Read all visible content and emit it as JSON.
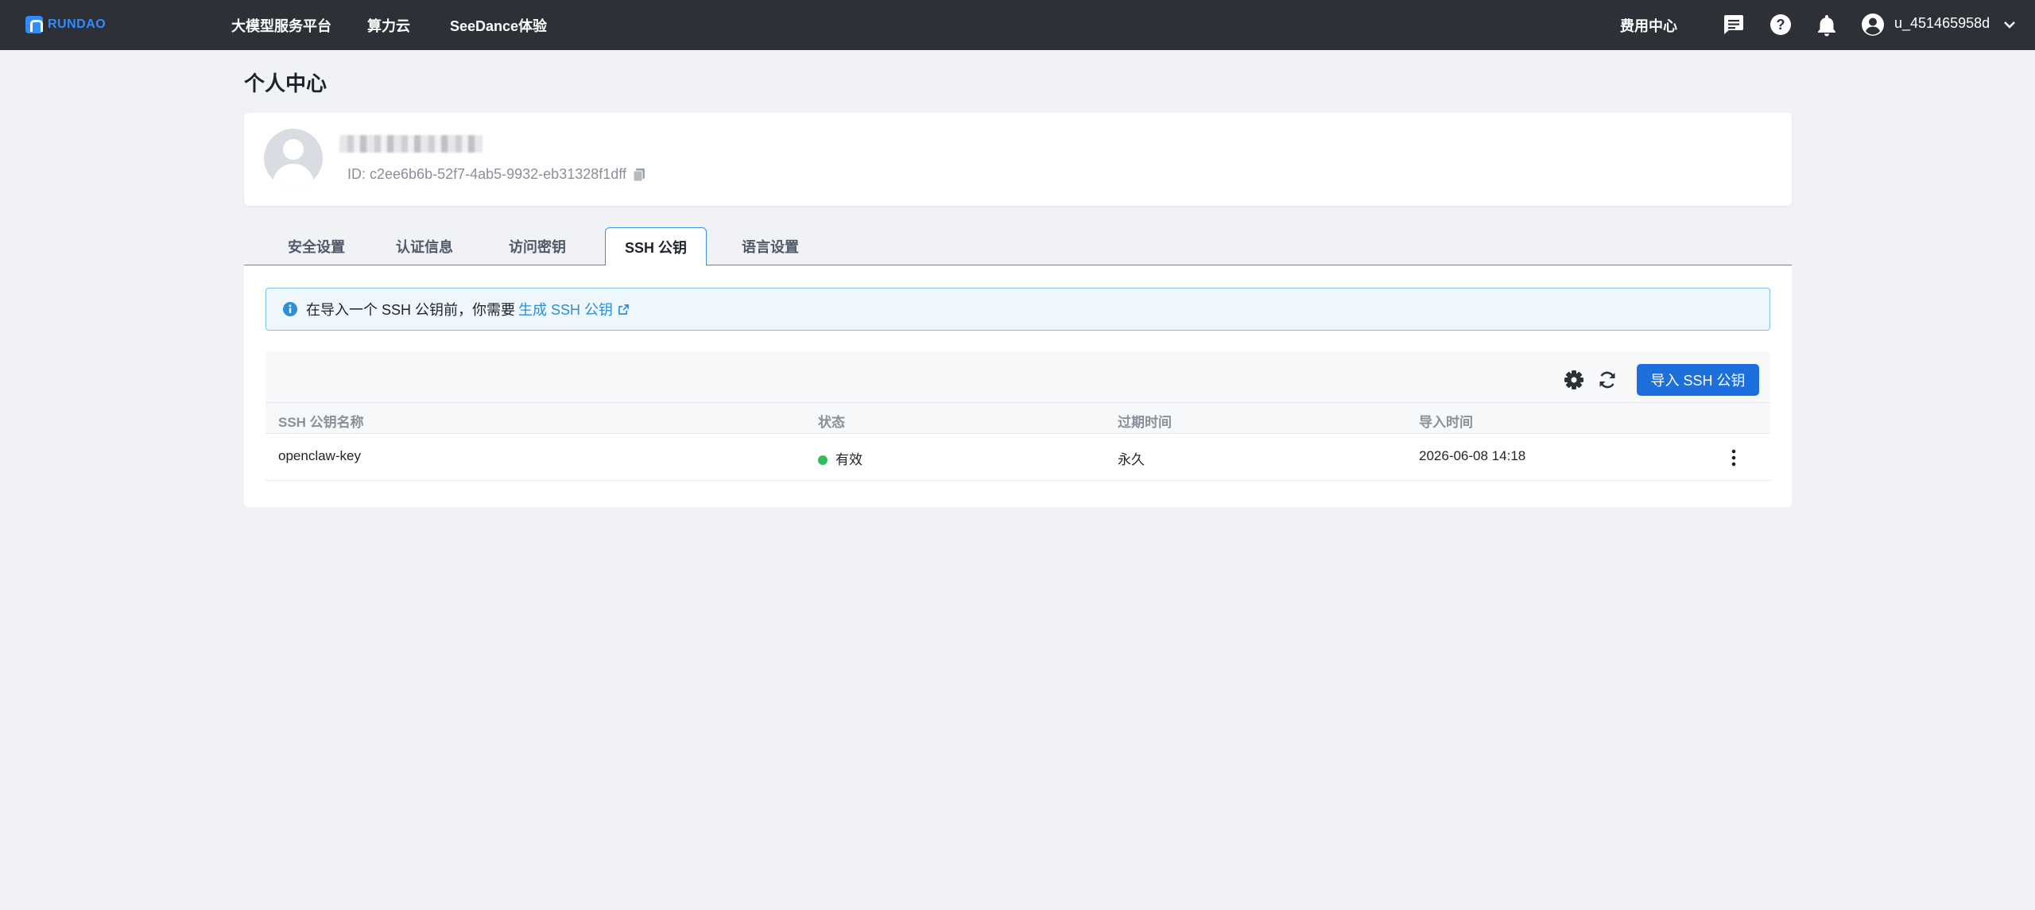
{
  "topbar": {
    "logo_text": "RUNDAO",
    "nav": [
      "大模型服务平台",
      "算力云",
      "SeeDance体验"
    ],
    "billing": "费用中心",
    "username": "u_451465958d",
    "icons": [
      "message-icon",
      "help-icon",
      "bell-icon",
      "user-icon",
      "chevron-down-icon"
    ]
  },
  "page": {
    "title": "个人中心"
  },
  "profile": {
    "id_label": "ID: c2ee6b6b-52f7-4ab5-9932-eb31328f1dff"
  },
  "tabs": [
    "安全设置",
    "认证信息",
    "访问密钥",
    "SSH 公钥",
    "语言设置"
  ],
  "active_tab": "SSH 公钥",
  "alert": {
    "text": "在导入一个 SSH 公钥前，你需要",
    "link": "生成 SSH 公钥"
  },
  "table": {
    "import_button": "导入 SSH 公钥",
    "columns": [
      "SSH 公钥名称",
      "状态",
      "过期时间",
      "导入时间"
    ],
    "rows": [
      {
        "name": "openclaw-key",
        "status": "有效",
        "expiry": "永久",
        "imported": "2026-06-08 14:18"
      }
    ]
  },
  "colors": {
    "topbar_bg": "#2d3036",
    "accent": "#1e6fde",
    "status_ok": "#2ebd59",
    "link": "#2b8fd9"
  }
}
